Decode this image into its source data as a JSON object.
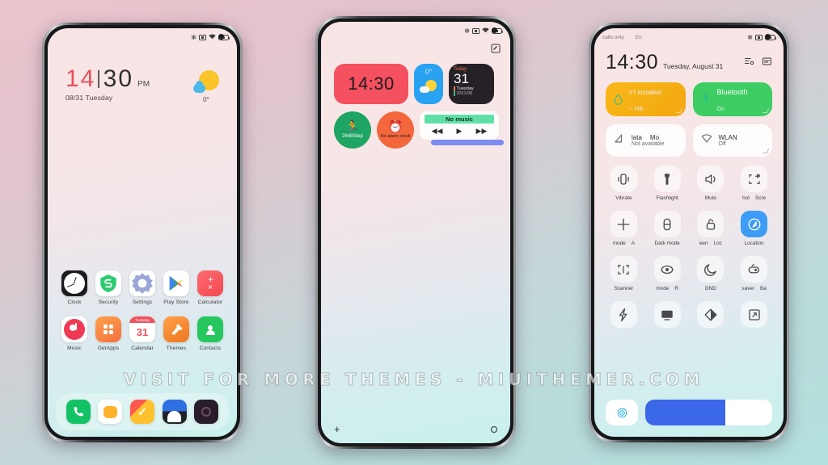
{
  "watermark": "VISIT FOR MORE THEMES - MIUITHEMER.COM",
  "phone1": {
    "statusbar": {
      "icons": [
        "bluetooth-icon",
        "vpn-icon",
        "wifi-icon",
        "battery-icon"
      ]
    },
    "clock": {
      "hour": "14",
      "minute": "30",
      "meridiem": "PM",
      "date": "08/31 Tuesday"
    },
    "weather": {
      "temperature": "0°",
      "condition_icon": "sun-behind-cloud-icon"
    },
    "apps": [
      {
        "label": "Clock",
        "icon": "clock-app-icon"
      },
      {
        "label": "Security",
        "icon": "security-shield-icon"
      },
      {
        "label": "Settings",
        "icon": "settings-gear-icon"
      },
      {
        "label": "Play Store",
        "icon": "play-store-icon"
      },
      {
        "label": "Calculator",
        "icon": "calculator-icon"
      },
      {
        "label": "Music",
        "icon": "music-note-icon"
      },
      {
        "label": "GetApps",
        "icon": "getapps-grid-icon"
      },
      {
        "label": "Calendar",
        "icon": "calendar-icon"
      },
      {
        "label": "Themes",
        "icon": "themes-brush-icon"
      },
      {
        "label": "Contacts",
        "icon": "contacts-person-icon"
      }
    ],
    "calendar_icon": {
      "weekday": "Tuesday",
      "day": "31"
    },
    "dock": [
      {
        "name": "phone",
        "icon": "phone-handset-icon"
      },
      {
        "name": "notes",
        "icon": "notes-icon"
      },
      {
        "name": "tasks",
        "icon": "tasks-check-icon"
      },
      {
        "name": "browser",
        "icon": "browser-icon"
      },
      {
        "name": "camera",
        "icon": "camera-icon"
      }
    ]
  },
  "phone2": {
    "statusbar": {
      "icons": [
        "bluetooth-icon",
        "vpn-icon",
        "wifi-icon",
        "battery-icon"
      ]
    },
    "edit_icon": "edit-pencil-icon",
    "widgets": {
      "clock": {
        "time": "14:30"
      },
      "weather": {
        "temperature": "0°",
        "condition_icon": "sun-behind-cloud-icon"
      },
      "calendar": {
        "header": "Today",
        "day": "31",
        "weekday": "Tuesday",
        "month": "2021/08"
      },
      "steps": {
        "icon": "running-person-icon",
        "value": "2648Step"
      },
      "alarm": {
        "icon": "alarm-clock-icon",
        "label": "No alarm clock"
      },
      "music": {
        "title": "No music",
        "prev_icon": "previous-track-icon",
        "play_icon": "play-icon",
        "next_icon": "next-track-icon"
      }
    },
    "bottom": {
      "add_icon": "plus-icon",
      "indicator_icon": "circle-icon"
    }
  },
  "phone3": {
    "statusbar": {
      "carrier": "calls only",
      "network": "En",
      "icons": [
        "bluetooth-icon",
        "vpn-icon",
        "battery-icon"
      ]
    },
    "header": {
      "time": "14:30",
      "date": "Tuesday, August 31",
      "actions": [
        "settings-list-icon",
        "notifications-icon"
      ]
    },
    "big_tiles": [
      {
        "title": "n't installed",
        "subtitle": "-- MB",
        "icon": "data-drop-icon",
        "color": "#f9b717"
      },
      {
        "title": "Bluetooth",
        "subtitle": "On",
        "icon": "bluetooth-icon",
        "color": "#3dcd63"
      }
    ],
    "mid_tiles": [
      {
        "title_a": "lata",
        "title_b": "Mo",
        "subtitle": "Not available",
        "icon": "mobile-data-icon"
      },
      {
        "title": "WLAN",
        "subtitle": "Off",
        "icon": "wifi-icon"
      }
    ],
    "toggles": [
      {
        "label": "Vibrate",
        "icon": "vibrate-icon",
        "active": false
      },
      {
        "label": "Flashlight",
        "icon": "flashlight-icon",
        "active": false
      },
      {
        "label": "Mute",
        "icon": "mute-icon",
        "active": false
      },
      {
        "label_a": "hot",
        "label_b": "Scre",
        "icon": "screenshot-icon",
        "active": false
      },
      {
        "label_a": "mode",
        "label_b": "A",
        "icon": "airplane-mode-icon",
        "active": false
      },
      {
        "label": "Dark mode",
        "icon": "dark-mode-icon",
        "active": false
      },
      {
        "label_a": "een",
        "label_b": "Loc",
        "icon": "screen-lock-icon",
        "active": false
      },
      {
        "label": "Location",
        "icon": "location-icon",
        "active": true
      },
      {
        "label": "Scanner",
        "icon": "scanner-icon",
        "active": false
      },
      {
        "label_a": "mode",
        "label_b": "R",
        "icon": "reading-mode-icon",
        "active": false
      },
      {
        "label": "DND",
        "icon": "dnd-moon-icon",
        "active": false
      },
      {
        "label_a": "saver",
        "label_b": "Ba",
        "icon": "battery-saver-icon",
        "active": false
      },
      {
        "label": "",
        "icon": "power-flash-icon",
        "active": false
      },
      {
        "label": "",
        "icon": "cast-screen-icon",
        "active": false
      },
      {
        "label": "",
        "icon": "contrast-icon",
        "active": false
      },
      {
        "label": "",
        "icon": "rotate-screen-icon",
        "active": false
      }
    ],
    "brightness": {
      "auto_icon": "auto-brightness-icon",
      "value": 63
    }
  }
}
